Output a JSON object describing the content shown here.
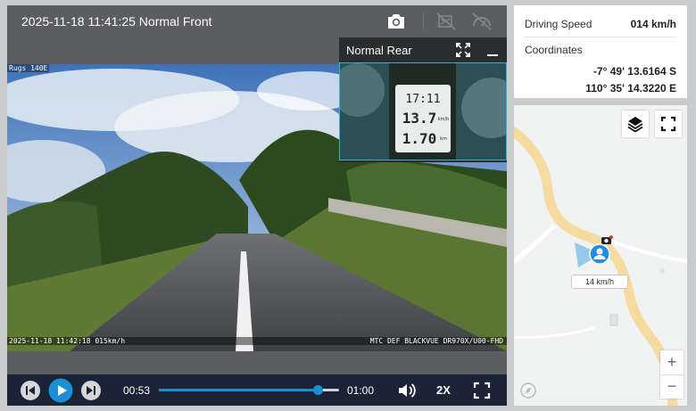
{
  "video": {
    "title": "2025-11-18 11:41:25 Normal Front",
    "osd_top": "Rugs 140E",
    "osd_timestamp": "2025-11-18 11:42:18 015km/h",
    "osd_device": "MTC DEF BLACKVUE DR970X/U00-FHD",
    "icons": [
      "camera-icon",
      "camera-off-icon",
      "speedometer-off-icon"
    ]
  },
  "rear": {
    "title": "Normal Rear",
    "gauge_lines": [
      "17:11",
      "13.7",
      "1.70"
    ],
    "gauge_units": [
      "km/h",
      "km"
    ]
  },
  "controls": {
    "current_time": "00:53",
    "total_time": "01:00",
    "progress": 0.883,
    "speed_label": "2X"
  },
  "info": {
    "speed_label": "Driving Speed",
    "speed_value": "014 km/h",
    "coordinates_label": "Coordinates",
    "latitude": "-7° 49' 13.6164 S",
    "longitude": "110° 35' 14.3220 E"
  },
  "map": {
    "speed_tag": "14 km/h",
    "zoom_in": "+",
    "zoom_out": "−"
  },
  "colors": {
    "accent": "#1a8fd6",
    "control_bar": "#1b2336",
    "road_map": "#f5dba0"
  }
}
